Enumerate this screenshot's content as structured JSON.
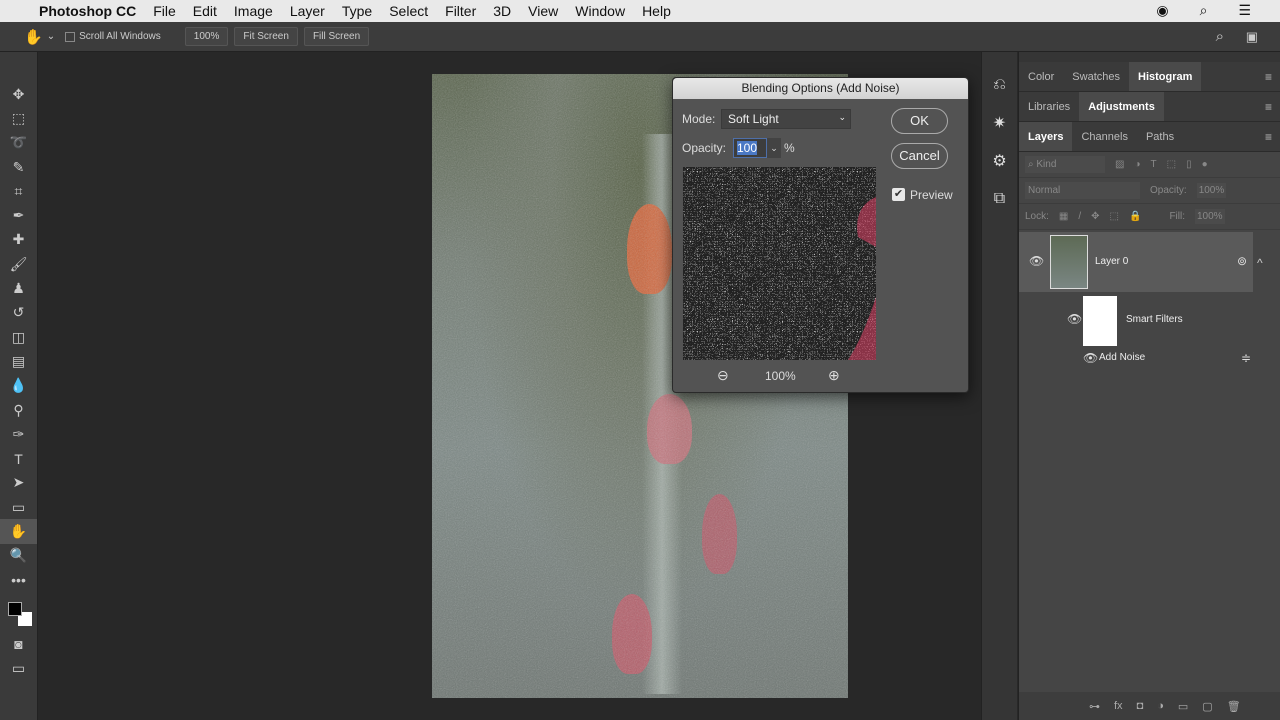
{
  "menubar": {
    "app": "Photoshop CC",
    "items": [
      "File",
      "Edit",
      "Image",
      "Layer",
      "Type",
      "Select",
      "Filter",
      "3D",
      "View",
      "Window",
      "Help"
    ],
    "right_icons": [
      "creative-cloud-icon",
      "search-icon",
      "list-icon"
    ]
  },
  "options": {
    "scroll_all": "Scroll All Windows",
    "zoom": "100%",
    "fit": "Fit Screen",
    "fill": "Fill Screen"
  },
  "tools": [
    {
      "n": "move",
      "g": "✥"
    },
    {
      "n": "marquee",
      "g": "⬚"
    },
    {
      "n": "lasso",
      "g": "➰"
    },
    {
      "n": "quick-select",
      "g": "✎"
    },
    {
      "n": "crop",
      "g": "⌗"
    },
    {
      "n": "eyedropper",
      "g": "✒"
    },
    {
      "n": "healing",
      "g": "✚"
    },
    {
      "n": "brush",
      "g": "🖌"
    },
    {
      "n": "stamp",
      "g": "♟"
    },
    {
      "n": "history-brush",
      "g": "↺"
    },
    {
      "n": "eraser",
      "g": "◫"
    },
    {
      "n": "gradient",
      "g": "▤"
    },
    {
      "n": "blur",
      "g": "💧"
    },
    {
      "n": "dodge",
      "g": "⚲"
    },
    {
      "n": "pen",
      "g": "✑"
    },
    {
      "n": "type",
      "g": "T"
    },
    {
      "n": "path-select",
      "g": "➤"
    },
    {
      "n": "rectangle",
      "g": "▭"
    },
    {
      "n": "hand",
      "g": "✋"
    },
    {
      "n": "zoom",
      "g": "🔍"
    },
    {
      "n": "more",
      "g": "•••"
    }
  ],
  "dialog": {
    "title": "Blending Options (Add Noise)",
    "mode_label": "Mode:",
    "mode": "Soft Light",
    "opacity_label": "Opacity:",
    "opacity": "100",
    "percent": "%",
    "ok": "OK",
    "cancel": "Cancel",
    "preview": "Preview",
    "preview_checked": true,
    "zoom": "100%"
  },
  "panels": {
    "row1": [
      "Color",
      "Swatches",
      "Histogram"
    ],
    "row2": [
      "Libraries",
      "Adjustments"
    ],
    "row3": [
      "Layers",
      "Channels",
      "Paths"
    ],
    "kind": "Kind",
    "blend": "Normal",
    "opacity_label": "Opacity:",
    "opacity": "100%",
    "lock": "Lock:",
    "fill_label": "Fill:",
    "fill": "100%",
    "layers": {
      "layer0": "Layer 0",
      "smart": "Smart Filters",
      "noise": "Add Noise"
    }
  },
  "colors": {
    "accent": "#4a78c4",
    "panel": "#454545"
  }
}
